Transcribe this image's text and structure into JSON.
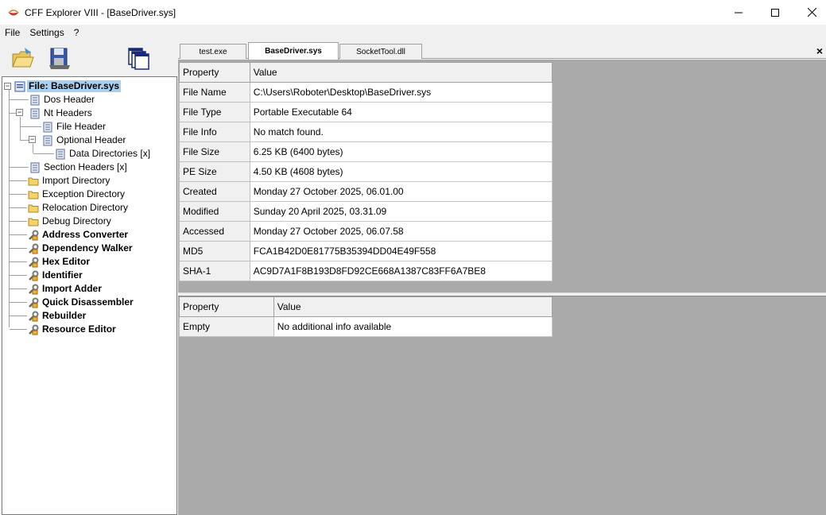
{
  "window": {
    "title": "CFF Explorer VIII - [BaseDriver.sys]"
  },
  "menu": [
    "File",
    "Settings",
    "?"
  ],
  "tree": {
    "root": "File: BaseDriver.sys",
    "items": [
      {
        "label": "Dos Header"
      },
      {
        "label": "Nt Headers"
      },
      {
        "label": "File Header"
      },
      {
        "label": "Optional Header"
      },
      {
        "label": "Data Directories [x]"
      },
      {
        "label": "Section Headers [x]"
      },
      {
        "label": "Import Directory"
      },
      {
        "label": "Exception Directory"
      },
      {
        "label": "Relocation Directory"
      },
      {
        "label": "Debug Directory"
      }
    ],
    "tools": [
      "Address Converter",
      "Dependency Walker",
      "Hex Editor",
      "Identifier",
      "Import Adder",
      "Quick Disassembler",
      "Rebuilder",
      "Resource Editor"
    ]
  },
  "tabs": [
    "test.exe",
    "BaseDriver.sys",
    "SocketTool.dll"
  ],
  "active_tab": 1,
  "grid1": {
    "headers": [
      "Property",
      "Value"
    ],
    "rows": [
      [
        "File Name",
        "C:\\Users\\Roboter\\Desktop\\BaseDriver.sys"
      ],
      [
        "File Type",
        "Portable Executable 64"
      ],
      [
        "File Info",
        "No match found."
      ],
      [
        "File Size",
        "6.25 KB (6400 bytes)"
      ],
      [
        "PE Size",
        "4.50 KB (4608 bytes)"
      ],
      [
        "Created",
        "Monday 27 October 2025, 06.01.00"
      ],
      [
        "Modified",
        "Sunday 20 April 2025, 03.31.09"
      ],
      [
        "Accessed",
        "Monday 27 October 2025, 06.07.58"
      ],
      [
        "MD5",
        "FCA1B42D0E81775B35394DD04E49F558"
      ],
      [
        "SHA-1",
        "AC9D7A1F8B193D8FD92CE668A1387C83FF6A7BE8"
      ]
    ]
  },
  "grid2": {
    "headers": [
      "Property",
      "Value"
    ],
    "rows": [
      [
        "Empty",
        "No additional info available"
      ]
    ]
  },
  "colors": {
    "selection": "#a8d0f0",
    "content_bg": "#aaaaaa"
  }
}
